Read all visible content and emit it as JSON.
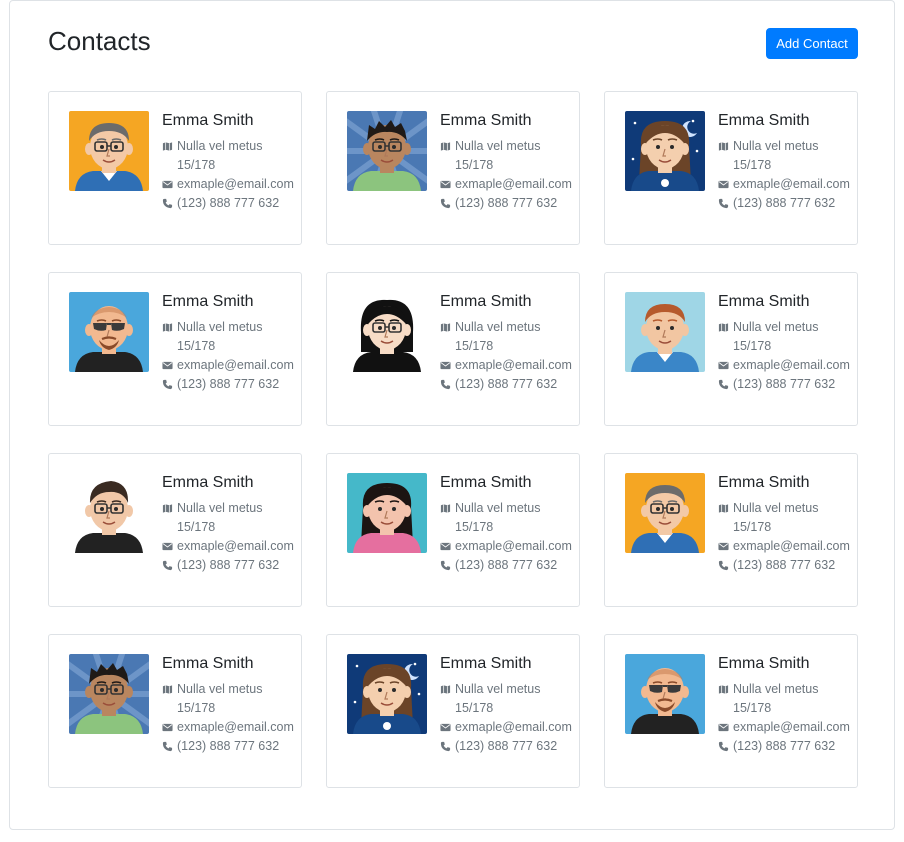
{
  "page": {
    "title": "Contacts",
    "add_button": "Add Contact"
  },
  "colors": {
    "accent": "#007bff",
    "muted": "#6c757d",
    "border": "#dee2e6"
  },
  "contacts": [
    {
      "name": "Emma Smith",
      "address1": "Nulla vel metus",
      "address2": "15/178",
      "email": "exmaple@email.com",
      "phone": "(123) 888 777 632",
      "avatar": "man-gray-hair-glasses-orange-bg"
    },
    {
      "name": "Emma Smith",
      "address1": "Nulla vel metus",
      "address2": "15/178",
      "email": "exmaple@email.com",
      "phone": "(123) 888 777 632",
      "avatar": "man-dark-hair-glasses-blue-bg"
    },
    {
      "name": "Emma Smith",
      "address1": "Nulla vel metus",
      "address2": "15/178",
      "email": "exmaple@email.com",
      "phone": "(123) 888 777 632",
      "avatar": "woman-brown-hair-night-bg"
    },
    {
      "name": "Emma Smith",
      "address1": "Nulla vel metus",
      "address2": "15/178",
      "email": "exmaple@email.com",
      "phone": "(123) 888 777 632",
      "avatar": "man-sunglasses-beard-blue-bg"
    },
    {
      "name": "Emma Smith",
      "address1": "Nulla vel metus",
      "address2": "15/178",
      "email": "exmaple@email.com",
      "phone": "(123) 888 777 632",
      "avatar": "man-black-hair-glasses-white-bg"
    },
    {
      "name": "Emma Smith",
      "address1": "Nulla vel metus",
      "address2": "15/178",
      "email": "exmaple@email.com",
      "phone": "(123) 888 777 632",
      "avatar": "man-red-hair-light-blue-bg"
    },
    {
      "name": "Emma Smith",
      "address1": "Nulla vel metus",
      "address2": "15/178",
      "email": "exmaple@email.com",
      "phone": "(123) 888 777 632",
      "avatar": "man-dark-hair-glasses-white-bg"
    },
    {
      "name": "Emma Smith",
      "address1": "Nulla vel metus",
      "address2": "15/178",
      "email": "exmaple@email.com",
      "phone": "(123) 888 777 632",
      "avatar": "woman-black-hair-teal-bg"
    },
    {
      "name": "Emma Smith",
      "address1": "Nulla vel metus",
      "address2": "15/178",
      "email": "exmaple@email.com",
      "phone": "(123) 888 777 632",
      "avatar": "man-gray-hair-glasses-orange-bg"
    },
    {
      "name": "Emma Smith",
      "address1": "Nulla vel metus",
      "address2": "15/178",
      "email": "exmaple@email.com",
      "phone": "(123) 888 777 632",
      "avatar": "man-dark-hair-glasses-blue-bg"
    },
    {
      "name": "Emma Smith",
      "address1": "Nulla vel metus",
      "address2": "15/178",
      "email": "exmaple@email.com",
      "phone": "(123) 888 777 632",
      "avatar": "woman-brown-hair-night-bg"
    },
    {
      "name": "Emma Smith",
      "address1": "Nulla vel metus",
      "address2": "15/178",
      "email": "exmaple@email.com",
      "phone": "(123) 888 777 632",
      "avatar": "man-sunglasses-beard-blue-bg"
    }
  ]
}
